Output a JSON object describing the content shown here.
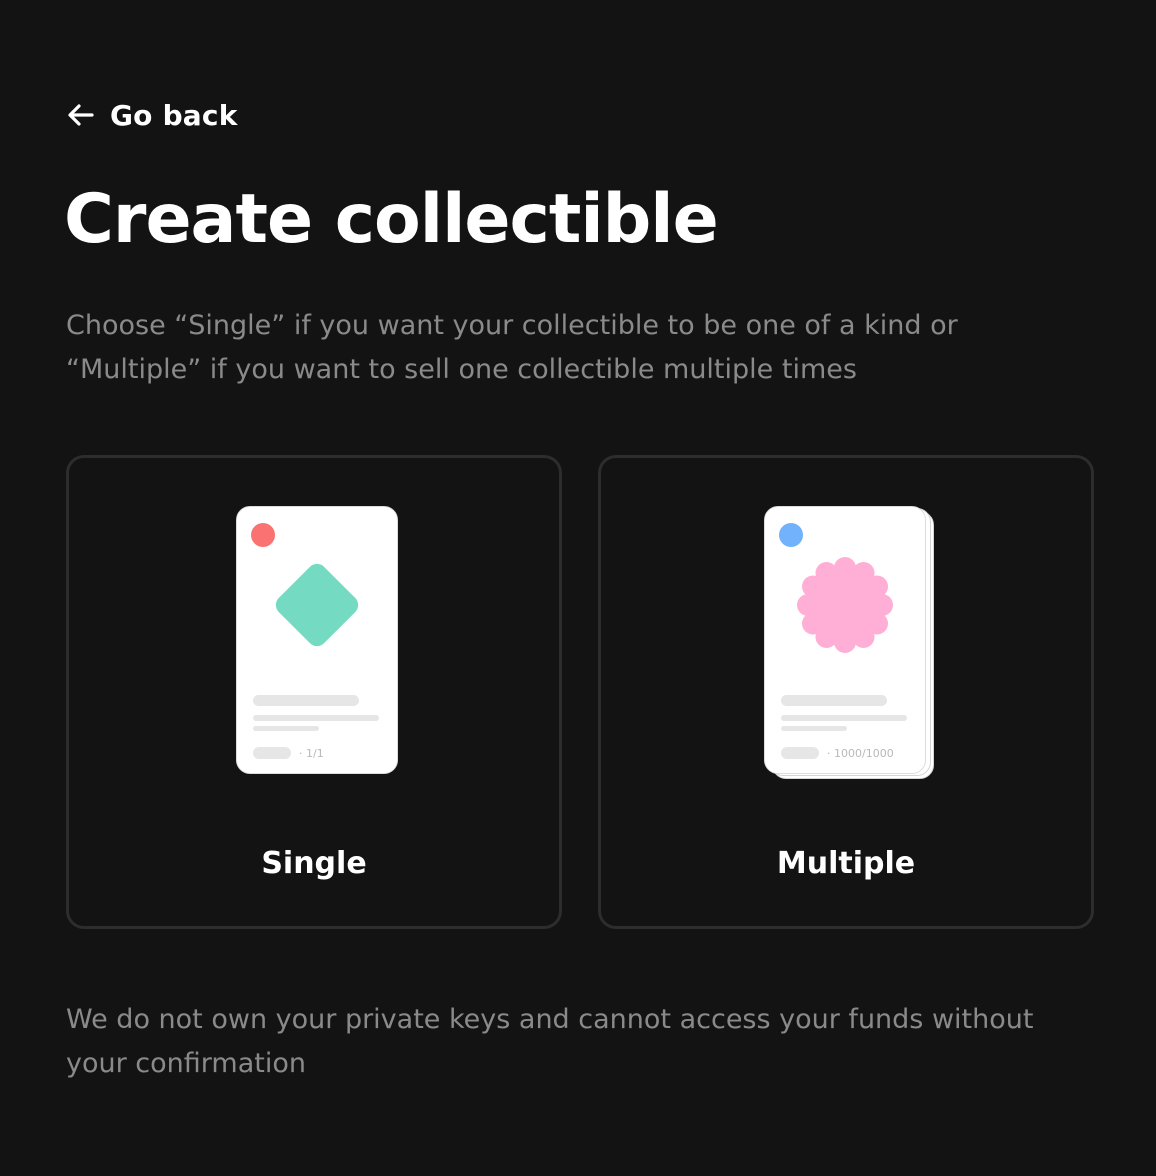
{
  "nav": {
    "back_label": "Go back"
  },
  "header": {
    "title": "Create collectible",
    "description": "Choose “Single” if you want your collectible to be one of a kind or “Multiple” if you want to sell one collectible multiple times"
  },
  "options": [
    {
      "label": "Single",
      "edition": "· 1/1",
      "dot_color": "#fb7272",
      "shape": "diamond",
      "shape_color": "#74dbc2"
    },
    {
      "label": "Multiple",
      "edition": "· 1000/1000",
      "dot_color": "#72b1fb",
      "shape": "flower",
      "shape_color": "#ffaed6"
    }
  ],
  "footer": {
    "note": "We do not own your private keys and cannot access your funds without your confirmation"
  },
  "colors": {
    "background": "#131313",
    "card_border": "#2d2d2d",
    "muted_text": "#8a8a8a"
  }
}
